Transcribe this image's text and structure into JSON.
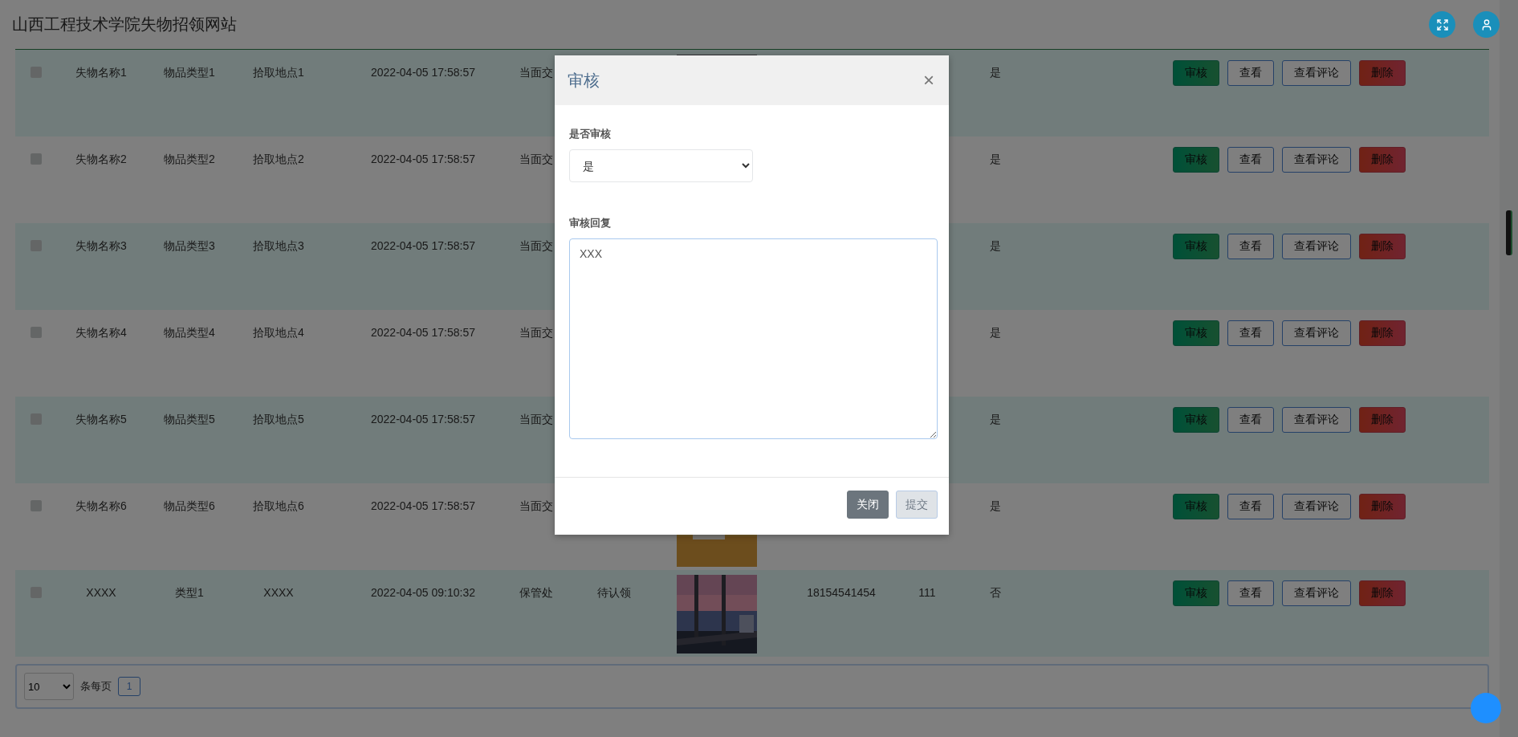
{
  "header": {
    "title": "山西工程技术学院失物招领网站"
  },
  "rows": [
    {
      "checked": false,
      "name": "失物名称1",
      "type": "物品类型1",
      "location": "拾取地点1",
      "time": "2022-04-05 17:58:57",
      "method": "当面交",
      "approved": "是",
      "actions": [
        {
          "label": "审核",
          "kind": "approve"
        },
        {
          "label": "查看",
          "kind": "view"
        },
        {
          "label": "查看评论",
          "kind": "view"
        },
        {
          "label": "删除",
          "kind": "delete"
        }
      ]
    },
    {
      "checked": false,
      "name": "失物名称2",
      "type": "物品类型2",
      "location": "拾取地点2",
      "time": "2022-04-05 17:58:57",
      "method": "当面交",
      "approved": "是",
      "actions": [
        {
          "label": "审核",
          "kind": "approve"
        },
        {
          "label": "查看",
          "kind": "view"
        },
        {
          "label": "查看评论",
          "kind": "view"
        },
        {
          "label": "删除",
          "kind": "delete"
        }
      ]
    },
    {
      "checked": false,
      "name": "失物名称3",
      "type": "物品类型3",
      "location": "拾取地点3",
      "time": "2022-04-05 17:58:57",
      "method": "当面交",
      "approved": "是",
      "actions": [
        {
          "label": "审核",
          "kind": "approve"
        },
        {
          "label": "查看",
          "kind": "view"
        },
        {
          "label": "查看评论",
          "kind": "view"
        },
        {
          "label": "删除",
          "kind": "delete"
        }
      ]
    },
    {
      "checked": false,
      "name": "失物名称4",
      "type": "物品类型4",
      "location": "拾取地点4",
      "time": "2022-04-05 17:58:57",
      "method": "当面交",
      "approved": "是",
      "actions": [
        {
          "label": "审核",
          "kind": "approve"
        },
        {
          "label": "查看",
          "kind": "view"
        },
        {
          "label": "查看评论",
          "kind": "view"
        },
        {
          "label": "删除",
          "kind": "delete"
        }
      ]
    },
    {
      "checked": false,
      "name": "失物名称5",
      "type": "物品类型5",
      "location": "拾取地点5",
      "time": "2022-04-05 17:58:57",
      "method": "当面交",
      "approved": "是",
      "actions": [
        {
          "label": "审核",
          "kind": "approve"
        },
        {
          "label": "查看",
          "kind": "view"
        },
        {
          "label": "查看评论",
          "kind": "view"
        },
        {
          "label": "删除",
          "kind": "delete"
        }
      ]
    },
    {
      "checked": false,
      "name": "失物名称6",
      "type": "物品类型6",
      "location": "拾取地点6",
      "time": "2022-04-05 17:58:57",
      "method": "当面交",
      "approved": "是",
      "actions": [
        {
          "label": "审核",
          "kind": "approve"
        },
        {
          "label": "查看",
          "kind": "view"
        },
        {
          "label": "查看评论",
          "kind": "view"
        },
        {
          "label": "删除",
          "kind": "delete"
        }
      ]
    },
    {
      "checked": false,
      "name": "XXXX",
      "type": "类型1",
      "location": "XXXX",
      "time": "2022-04-05 09:10:32",
      "method": "保管处",
      "status": "待认领",
      "phone": "18154541454",
      "column_10": "111",
      "approved": "否",
      "actions": [
        {
          "label": "审核",
          "kind": "approve"
        },
        {
          "label": "查看",
          "kind": "view"
        },
        {
          "label": "查看评论",
          "kind": "view"
        },
        {
          "label": "删除",
          "kind": "delete"
        }
      ]
    }
  ],
  "pagination": {
    "page_size": "10",
    "per_page_label": "条每页",
    "pages": [
      {
        "label": "1",
        "selected": true
      }
    ]
  },
  "modal": {
    "title": "审核",
    "close": "×",
    "fields": [
      {
        "kind": "select",
        "label": "是否审核",
        "value": "是"
      },
      {
        "kind": "textarea",
        "label": "审核回复",
        "value": "XXX"
      }
    ],
    "buttons": [
      {
        "label": "关闭",
        "kind": "secondary",
        "disabled": false
      },
      {
        "label": "提交",
        "kind": "primary",
        "disabled": true
      }
    ]
  }
}
